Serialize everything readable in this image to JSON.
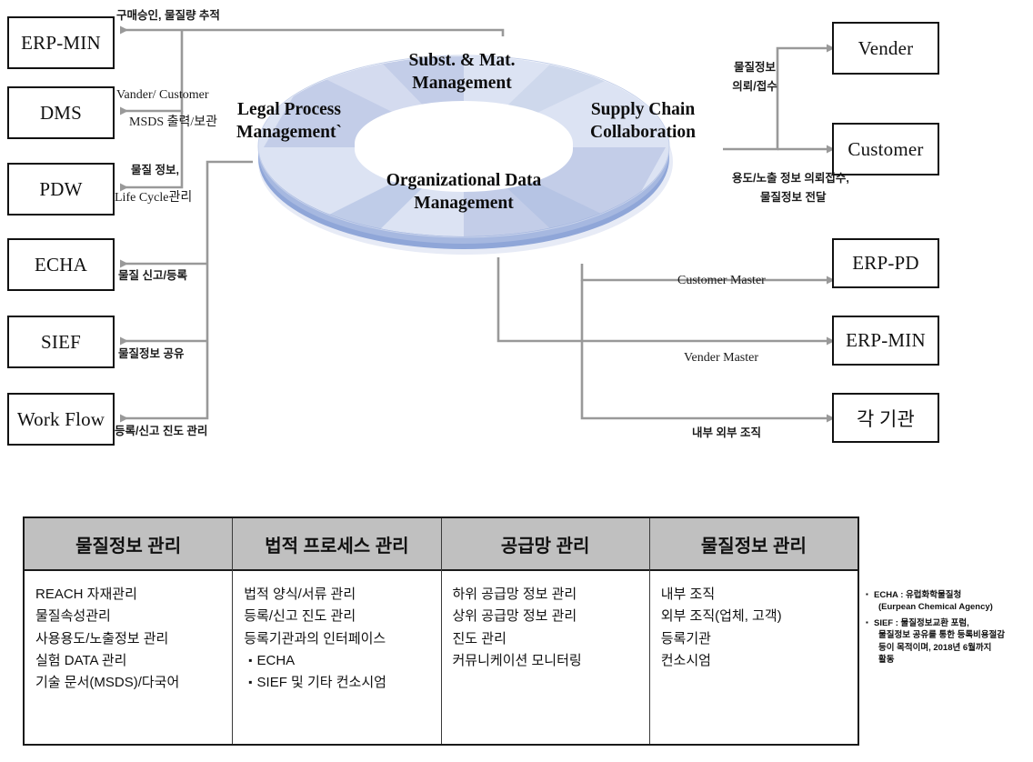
{
  "diagram": {
    "left_boxes": [
      {
        "id": "erp-min",
        "label": "ERP-MIN"
      },
      {
        "id": "dms",
        "label": "DMS"
      },
      {
        "id": "pdw",
        "label": "PDW"
      },
      {
        "id": "echa",
        "label": "ECHA"
      },
      {
        "id": "sief",
        "label": "SIEF"
      },
      {
        "id": "work-flow",
        "label": "Work Flow"
      }
    ],
    "right_boxes": [
      {
        "id": "vender",
        "label": "Vender"
      },
      {
        "id": "customer",
        "label": "Customer"
      },
      {
        "id": "erp-pd",
        "label": "ERP-PD"
      },
      {
        "id": "erp-min-right",
        "label": "ERP-MIN"
      },
      {
        "id": "agency",
        "label": "각 기관"
      }
    ],
    "donut": {
      "quadrants": [
        {
          "id": "subst-mat",
          "line1": "Subst. & Mat.",
          "line2": "Management"
        },
        {
          "id": "supply-chain",
          "line1": "Supply Chain",
          "line2": "Collaboration"
        },
        {
          "id": "org-data",
          "line1": "Organizational Data",
          "line2": "Management"
        },
        {
          "id": "legal-process",
          "line1": "Legal Process",
          "line2": "Management`"
        }
      ],
      "fill_light": "#dce3f3",
      "fill_mid": "#c3cde8",
      "fill_dark": "#9fb2dd"
    },
    "edge_labels": [
      {
        "id": "purchase-approval",
        "text": "구매승인, 물질량 추적"
      },
      {
        "id": "vander-customer",
        "text": "Vander/  Customer"
      },
      {
        "id": "msds-print",
        "text": "MSDS 출력/보관"
      },
      {
        "id": "substance-info",
        "text": "물질 정보,"
      },
      {
        "id": "life-cycle",
        "text": "Life Cycle관리"
      },
      {
        "id": "substance-report",
        "text": "물질 신고/등록"
      },
      {
        "id": "substance-share",
        "text": "물질정보 공유"
      },
      {
        "id": "registration-progress",
        "text": "등록/신고 진도 관리"
      },
      {
        "id": "material-info-request-1",
        "text": "물질정보"
      },
      {
        "id": "material-info-request-2",
        "text": "의뢰/접수"
      },
      {
        "id": "usage-exposure-1",
        "text": "용도/노출 정보 의뢰접수,"
      },
      {
        "id": "usage-exposure-2",
        "text": "물질정보 전달"
      },
      {
        "id": "customer-master",
        "text": "Customer Master"
      },
      {
        "id": "vender-master",
        "text": "Vender  Master"
      },
      {
        "id": "internal-external",
        "text": "내부 외부 조직"
      }
    ],
    "arrow_color": "#999999"
  },
  "table": {
    "columns": [
      {
        "id": "material-info-management",
        "header": "물질정보 관리",
        "items": [
          {
            "text": "REACH 자재관리",
            "sub": false
          },
          {
            "text": "물질속성관리",
            "sub": false
          },
          {
            "text": "사용용도/노출정보 관리",
            "sub": false
          },
          {
            "text": "실험 DATA 관리",
            "sub": false
          },
          {
            "text": "기술 문서(MSDS)/다국어",
            "sub": false
          }
        ]
      },
      {
        "id": "legal-process-management",
        "header": "법적 프로세스 관리",
        "items": [
          {
            "text": "법적 양식/서류 관리",
            "sub": false
          },
          {
            "text": "등록/신고 진도 관리",
            "sub": false
          },
          {
            "text": "등록기관과의 인터페이스",
            "sub": false
          },
          {
            "text": "ECHA",
            "sub": true
          },
          {
            "text": "SIEF 및 기타 컨소시엄",
            "sub": true
          }
        ]
      },
      {
        "id": "supply-chain-management",
        "header": "공급망 관리",
        "items": [
          {
            "text": "하위 공급망 정보 관리",
            "sub": false
          },
          {
            "text": "상위 공급망 정보 관리",
            "sub": false
          },
          {
            "text": "진도 관리",
            "sub": false
          },
          {
            "text": "커뮤니케이션 모니터링",
            "sub": false
          }
        ]
      },
      {
        "id": "organization-management",
        "header": "물질정보 관리",
        "items": [
          {
            "text": "내부 조직",
            "sub": false
          },
          {
            "text": "외부 조직(업체, 고객)",
            "sub": false
          },
          {
            "text": "등록기관",
            "sub": false
          },
          {
            "text": "컨소시엄",
            "sub": false
          }
        ]
      }
    ],
    "header_bg": "#c0c0c0"
  },
  "footnotes": [
    {
      "id": "echa-note",
      "line1": "ECHA : 유럽화학물질청",
      "line2": "(Eurpean Chemical Agency)",
      "line3": "",
      "line4": ""
    },
    {
      "id": "sief-note",
      "line1": "SIEF : 물질정보교환 포럼,",
      "line2": "물질정보 공유를 통한 등록비용절감",
      "line3": "등이 목적이며, 2018년 6월까지",
      "line4": "활동"
    }
  ]
}
